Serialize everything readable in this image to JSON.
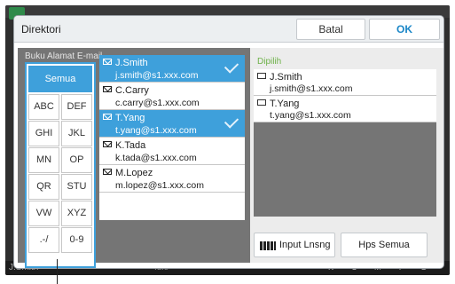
{
  "dialog": {
    "title": "Direktori",
    "cancel_label": "Batal",
    "ok_label": "OK"
  },
  "address_book": {
    "label": "Buku Alamat E-mail",
    "index": [
      "Semua",
      "ABC",
      "DEF",
      "GHI",
      "JKL",
      "MN",
      "OP",
      "QR",
      "STU",
      "VW",
      "XYZ",
      ".-/",
      "0-9"
    ],
    "selected_index": "Semua",
    "entries": [
      {
        "name": "J.Smith",
        "email": "j.smith@s1.xxx.com",
        "selected": true
      },
      {
        "name": "C.Carry",
        "email": "c.carry@s1.xxx.com",
        "selected": false
      },
      {
        "name": "T.Yang",
        "email": "t.yang@s1.xxx.com",
        "selected": true
      },
      {
        "name": "K.Tada",
        "email": "k.tada@s1.xxx.com",
        "selected": false
      },
      {
        "name": "M.Lopez",
        "email": "m.lopez@s1.xxx.com",
        "selected": false
      }
    ]
  },
  "picked": {
    "label": "Dipilih",
    "entries": [
      {
        "name": "J.Smith",
        "email": "j.smith@s1.xxx.com"
      },
      {
        "name": "T.Yang",
        "email": "t.yang@s1.xxx.com"
      }
    ]
  },
  "actions": {
    "input_label": "Input Lnsng",
    "clear_label": "Hps Semua"
  },
  "background": {
    "user": "J.Smith",
    "status": "Idle",
    "inks": [
      "K",
      "C",
      "M",
      "Y",
      "G"
    ]
  },
  "colors": {
    "accent": "#3ea0db",
    "picked_label": "#6fb24a"
  }
}
